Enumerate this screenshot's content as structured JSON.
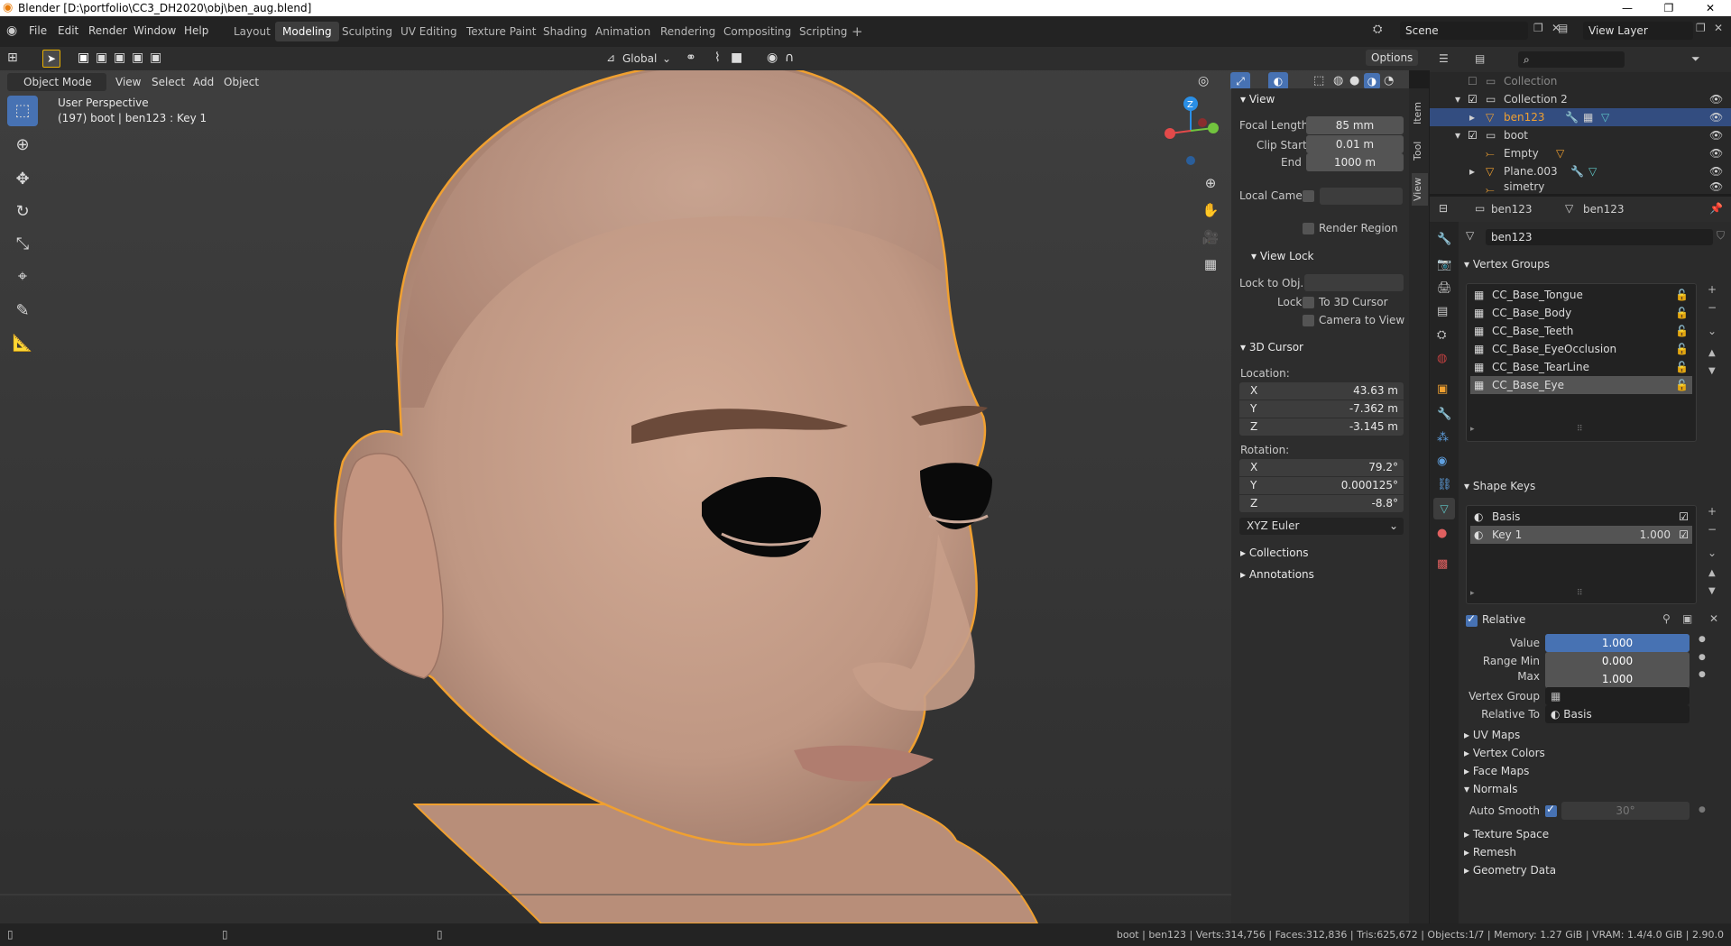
{
  "titlebar": {
    "title": "Blender [D:\\portfolio\\CC3_DH2020\\obj\\ben_aug.blend]",
    "minimize": "—",
    "maximize": "❐",
    "close": "✕"
  },
  "menu": {
    "file": "File",
    "edit": "Edit",
    "render": "Render",
    "window": "Window",
    "help": "Help"
  },
  "workspaces": [
    "Layout",
    "Modeling",
    "Sculpting",
    "UV Editing",
    "Texture Paint",
    "Shading",
    "Animation",
    "Rendering",
    "Compositing",
    "Scripting"
  ],
  "active_workspace": "Modeling",
  "scene": {
    "name": "Scene",
    "view_layer": "View Layer"
  },
  "viewport_header": {
    "transform_orientation": "Global",
    "options": "Options",
    "mode": "Object Mode",
    "view": "View",
    "select": "Select",
    "add": "Add",
    "object": "Object"
  },
  "viewport_overlay": {
    "perspective": "User Perspective",
    "info": "(197) boot | ben123 : Key 1"
  },
  "gizmo": {
    "z": "Z",
    "y": "Y",
    "x": "X"
  },
  "npanel": {
    "tabs": [
      "Item",
      "Tool",
      "View"
    ],
    "view_header": "View",
    "focal_length_label": "Focal Length",
    "focal_length": "85 mm",
    "clip_start_label": "Clip Start",
    "clip_start": "0.01 m",
    "end_label": "End",
    "clip_end": "1000 m",
    "local_camera_label": "Local Came...",
    "render_region": "Render Region",
    "view_lock_header": "View Lock",
    "lock_to_obj_label": "Lock to Obj...",
    "lock_label": "Lock",
    "to_3d_cursor": "To 3D Cursor",
    "camera_to_view": "Camera to View",
    "cursor_header": "3D Cursor",
    "location_label": "Location:",
    "loc_x": "43.63 m",
    "loc_y": "-7.362 m",
    "loc_z": "-3.145 m",
    "rotation_label": "Rotation:",
    "rot_x": "79.2°",
    "rot_y": "0.000125°",
    "rot_z": "-8.8°",
    "rotation_mode": "XYZ Euler",
    "collections": "Collections",
    "annotations": "Annotations",
    "axis_x": "X",
    "axis_y": "Y",
    "axis_z": "Z"
  },
  "outliner": {
    "rows": [
      {
        "name": "Collection",
        "dim": true
      },
      {
        "name": "Collection 2"
      },
      {
        "name": "ben123",
        "selected": true
      },
      {
        "name": "boot"
      },
      {
        "name": "Empty"
      },
      {
        "name": "Plane.003"
      },
      {
        "name": "simetry"
      }
    ]
  },
  "properties": {
    "breadcrumb_obj": "ben123",
    "breadcrumb_data": "ben123",
    "data_name": "ben123",
    "vertex_groups_header": "Vertex Groups",
    "vertex_groups": [
      "CC_Base_Tongue",
      "CC_Base_Body",
      "CC_Base_Teeth",
      "CC_Base_EyeOcclusion",
      "CC_Base_TearLine",
      "CC_Base_Eye"
    ],
    "shape_keys_header": "Shape Keys",
    "shape_keys": [
      {
        "name": "Basis",
        "value": ""
      },
      {
        "name": "Key 1",
        "value": "1.000"
      }
    ],
    "relative_label": "Relative",
    "value_label": "Value",
    "value": "1.000",
    "value_fraction": 1.0,
    "range_min_label": "Range Min",
    "range_min": "0.000",
    "max_label": "Max",
    "max": "1.000",
    "vertex_group_label": "Vertex Group",
    "relative_to_label": "Relative To",
    "relative_to": "Basis",
    "uv_maps": "UV Maps",
    "vertex_colors": "Vertex Colors",
    "face_maps": "Face Maps",
    "normals": "Normals",
    "auto_smooth_label": "Auto Smooth",
    "auto_smooth_angle": "30°",
    "texture_space": "Texture Space",
    "remesh": "Remesh",
    "geometry_data": "Geometry Data"
  },
  "statusbar": {
    "text": "boot | ben123 | Verts:314,756 | Faces:312,836 | Tris:625,672 | Objects:1/7 | Memory: 1.27 GiB | VRAM: 1.4/4.0 GiB | 2.90.0"
  },
  "colors": {
    "accent": "#4772b3",
    "selection_outline": "#f0a030",
    "skin": "#c9a08a"
  }
}
